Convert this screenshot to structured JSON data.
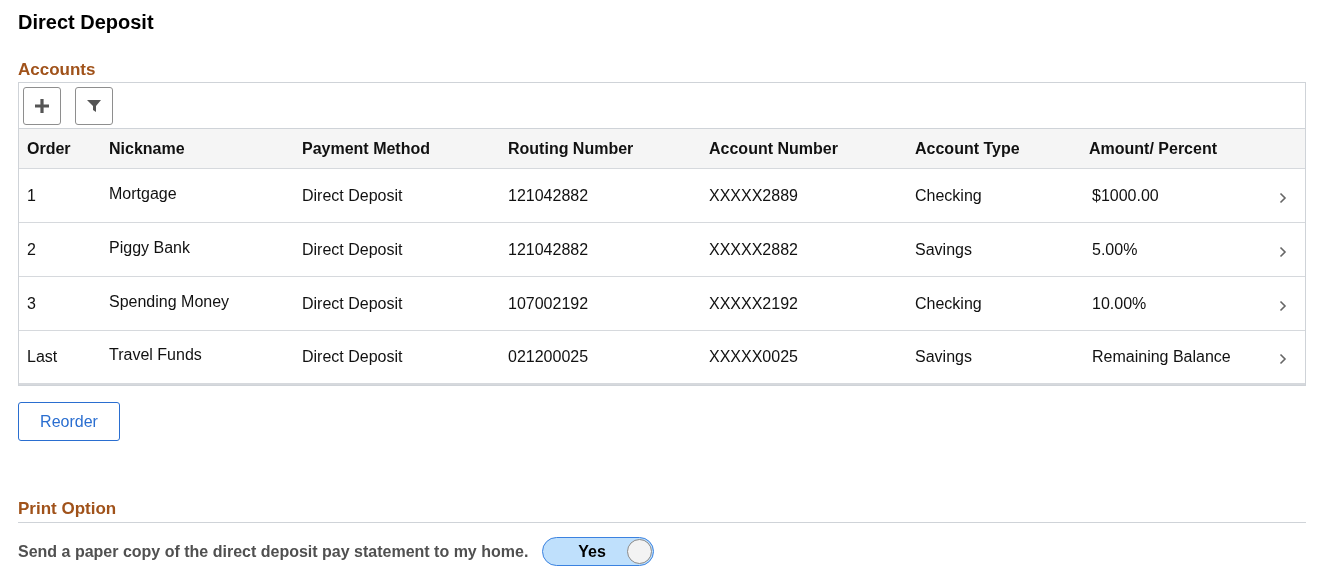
{
  "title": "Direct Deposit",
  "accounts": {
    "heading": "Accounts",
    "columns": [
      "Order",
      "Nickname",
      "Payment Method",
      "Routing Number",
      "Account Number",
      "Account Type",
      "Amount/ Percent"
    ],
    "rows": [
      {
        "cells": [
          "1",
          "Mortgage",
          "Direct Deposit",
          "121042882",
          "XXXXX2889",
          "Checking",
          "$1000.00"
        ]
      },
      {
        "cells": [
          "2",
          "Piggy Bank",
          "Direct Deposit",
          "121042882",
          "XXXXX2882",
          "Savings",
          "5.00%"
        ]
      },
      {
        "cells": [
          "3",
          "Spending Money",
          "Direct Deposit",
          "107002192",
          "XXXXX2192",
          "Checking",
          "10.00%"
        ]
      },
      {
        "cells": [
          "Last",
          "Travel Funds",
          "Direct Deposit",
          "021200025",
          "XXXXX0025",
          "Savings",
          "Remaining Balance"
        ]
      }
    ],
    "reorder_button": "Reorder"
  },
  "print_option": {
    "heading": "Print Option",
    "label": "Send a paper copy of the direct deposit pay statement to my home.",
    "toggle": {
      "text": "Yes",
      "on": true
    }
  }
}
